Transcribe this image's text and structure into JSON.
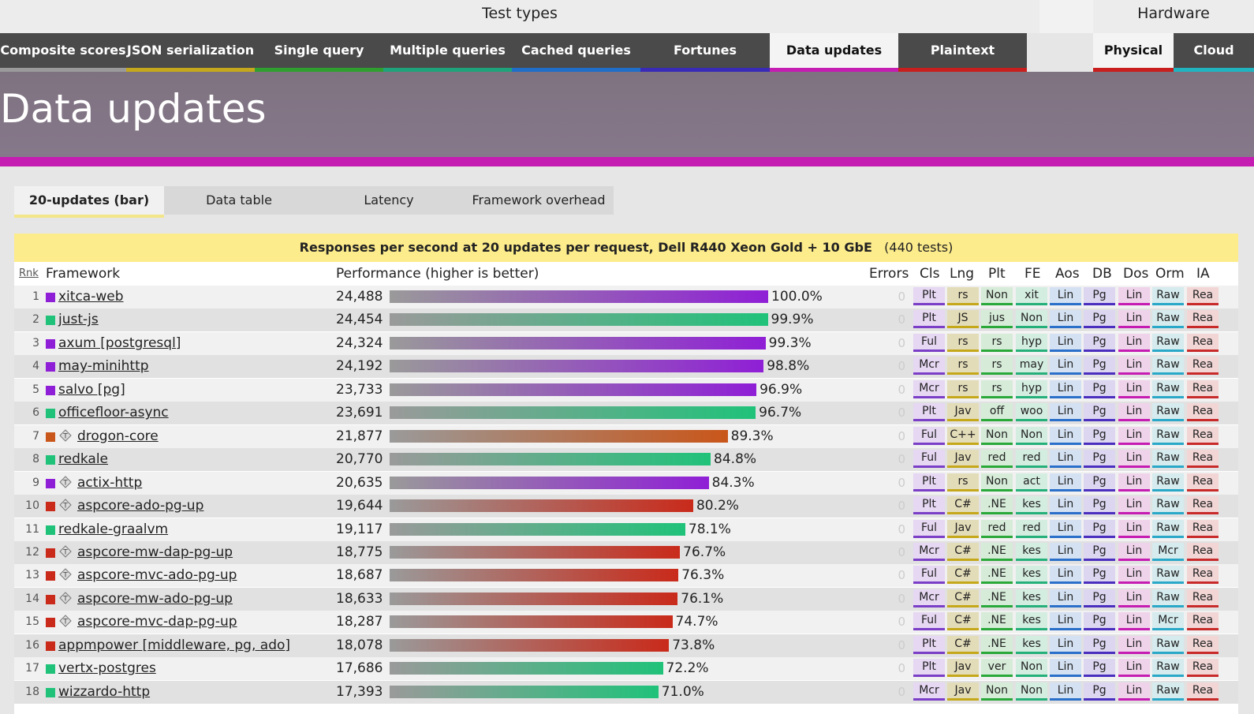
{
  "header": {
    "test_types_label": "Test types",
    "hardware_label": "Hardware"
  },
  "test_tabs": [
    {
      "label": "Composite scores",
      "color": "#9a9a9a",
      "active": false
    },
    {
      "label": "JSON serialization",
      "color": "#c4a71c",
      "active": false
    },
    {
      "label": "Single query",
      "color": "#2fa02f",
      "active": false
    },
    {
      "label": "Multiple queries",
      "color": "#1fa37a",
      "active": false
    },
    {
      "label": "Cached queries",
      "color": "#1f6ec8",
      "active": false
    },
    {
      "label": "Fortunes",
      "color": "#3a2ab8",
      "active": false
    },
    {
      "label": "Data updates",
      "color": "#c51cb2",
      "active": true
    },
    {
      "label": "Plaintext",
      "color": "#c81e1e",
      "active": false
    }
  ],
  "hardware_tabs": [
    {
      "label": "Physical",
      "color": "#c81e1e",
      "active": true
    },
    {
      "label": "Cloud",
      "color": "#1fb4c0",
      "active": false
    }
  ],
  "page_title": "Data updates",
  "sub_tabs": [
    {
      "label": "20-updates (bar)",
      "active": true
    },
    {
      "label": "Data table",
      "active": false
    },
    {
      "label": "Latency",
      "active": false
    },
    {
      "label": "Framework overhead",
      "active": false
    }
  ],
  "panel": {
    "title": "Responses per second at 20 updates per request, Dell R440 Xeon Gold + 10 GbE",
    "tests": "(440 tests)"
  },
  "columns": {
    "rnk": "Rnk",
    "framework": "Framework",
    "performance": "Performance (higher is better)",
    "errors": "Errors",
    "cls": "Cls",
    "lng": "Lng",
    "plt": "Plt",
    "fe": "FE",
    "aos": "Aos",
    "db": "DB",
    "dos": "Dos",
    "orm": "Orm",
    "ia": "IA"
  },
  "colors": {
    "purple": "#8f1fd6",
    "green": "#20c27a",
    "orange": "#c9561a",
    "red": "#c92a1a"
  },
  "rows": [
    {
      "rank": "1",
      "name": "xitca-web",
      "color": "purple",
      "tagged": false,
      "rps": "24,488",
      "pct_label": "100.0%",
      "pct": 100.0,
      "errors": "0",
      "attrs": [
        "Plt",
        "rs",
        "Non",
        "xit",
        "Lin",
        "Pg",
        "Lin",
        "Raw",
        "Rea"
      ]
    },
    {
      "rank": "2",
      "name": "just-js",
      "color": "green",
      "tagged": false,
      "rps": "24,454",
      "pct_label": "99.9%",
      "pct": 99.9,
      "errors": "0",
      "attrs": [
        "Plt",
        "JS",
        "jus",
        "Non",
        "Lin",
        "Pg",
        "Lin",
        "Raw",
        "Rea"
      ]
    },
    {
      "rank": "3",
      "name": "axum [postgresql]",
      "color": "purple",
      "tagged": false,
      "rps": "24,324",
      "pct_label": "99.3%",
      "pct": 99.3,
      "errors": "0",
      "attrs": [
        "Ful",
        "rs",
        "rs",
        "hyp",
        "Lin",
        "Pg",
        "Lin",
        "Raw",
        "Rea"
      ]
    },
    {
      "rank": "4",
      "name": "may-minihttp",
      "color": "purple",
      "tagged": false,
      "rps": "24,192",
      "pct_label": "98.8%",
      "pct": 98.8,
      "errors": "0",
      "attrs": [
        "Mcr",
        "rs",
        "rs",
        "may",
        "Lin",
        "Pg",
        "Lin",
        "Raw",
        "Rea"
      ]
    },
    {
      "rank": "5",
      "name": "salvo [pg]",
      "color": "purple",
      "tagged": false,
      "rps": "23,733",
      "pct_label": "96.9%",
      "pct": 96.9,
      "errors": "0",
      "attrs": [
        "Mcr",
        "rs",
        "rs",
        "hyp",
        "Lin",
        "Pg",
        "Lin",
        "Raw",
        "Rea"
      ]
    },
    {
      "rank": "6",
      "name": "officefloor-async",
      "color": "green",
      "tagged": false,
      "rps": "23,691",
      "pct_label": "96.7%",
      "pct": 96.7,
      "errors": "0",
      "attrs": [
        "Plt",
        "Jav",
        "off",
        "woo",
        "Lin",
        "Pg",
        "Lin",
        "Raw",
        "Rea"
      ]
    },
    {
      "rank": "7",
      "name": "drogon-core",
      "color": "orange",
      "tagged": true,
      "rps": "21,877",
      "pct_label": "89.3%",
      "pct": 89.3,
      "errors": "0",
      "attrs": [
        "Ful",
        "C++",
        "Non",
        "Non",
        "Lin",
        "Pg",
        "Lin",
        "Raw",
        "Rea"
      ]
    },
    {
      "rank": "8",
      "name": "redkale",
      "color": "green",
      "tagged": false,
      "rps": "20,770",
      "pct_label": "84.8%",
      "pct": 84.8,
      "errors": "0",
      "attrs": [
        "Ful",
        "Jav",
        "red",
        "red",
        "Lin",
        "Pg",
        "Lin",
        "Raw",
        "Rea"
      ]
    },
    {
      "rank": "9",
      "name": "actix-http",
      "color": "purple",
      "tagged": true,
      "rps": "20,635",
      "pct_label": "84.3%",
      "pct": 84.3,
      "errors": "0",
      "attrs": [
        "Plt",
        "rs",
        "Non",
        "act",
        "Lin",
        "Pg",
        "Lin",
        "Raw",
        "Rea"
      ]
    },
    {
      "rank": "10",
      "name": "aspcore-ado-pg-up",
      "color": "red",
      "tagged": true,
      "rps": "19,644",
      "pct_label": "80.2%",
      "pct": 80.2,
      "errors": "0",
      "attrs": [
        "Plt",
        "C#",
        ".NE",
        "kes",
        "Lin",
        "Pg",
        "Lin",
        "Raw",
        "Rea"
      ]
    },
    {
      "rank": "11",
      "name": "redkale-graalvm",
      "color": "green",
      "tagged": false,
      "rps": "19,117",
      "pct_label": "78.1%",
      "pct": 78.1,
      "errors": "0",
      "attrs": [
        "Ful",
        "Jav",
        "red",
        "red",
        "Lin",
        "Pg",
        "Lin",
        "Raw",
        "Rea"
      ]
    },
    {
      "rank": "12",
      "name": "aspcore-mw-dap-pg-up",
      "color": "red",
      "tagged": true,
      "rps": "18,775",
      "pct_label": "76.7%",
      "pct": 76.7,
      "errors": "0",
      "attrs": [
        "Mcr",
        "C#",
        ".NE",
        "kes",
        "Lin",
        "Pg",
        "Lin",
        "Mcr",
        "Rea"
      ]
    },
    {
      "rank": "13",
      "name": "aspcore-mvc-ado-pg-up",
      "color": "red",
      "tagged": true,
      "rps": "18,687",
      "pct_label": "76.3%",
      "pct": 76.3,
      "errors": "0",
      "attrs": [
        "Ful",
        "C#",
        ".NE",
        "kes",
        "Lin",
        "Pg",
        "Lin",
        "Raw",
        "Rea"
      ]
    },
    {
      "rank": "14",
      "name": "aspcore-mw-ado-pg-up",
      "color": "red",
      "tagged": true,
      "rps": "18,633",
      "pct_label": "76.1%",
      "pct": 76.1,
      "errors": "0",
      "attrs": [
        "Mcr",
        "C#",
        ".NE",
        "kes",
        "Lin",
        "Pg",
        "Lin",
        "Raw",
        "Rea"
      ]
    },
    {
      "rank": "15",
      "name": "aspcore-mvc-dap-pg-up",
      "color": "red",
      "tagged": true,
      "rps": "18,287",
      "pct_label": "74.7%",
      "pct": 74.7,
      "errors": "0",
      "attrs": [
        "Ful",
        "C#",
        ".NE",
        "kes",
        "Lin",
        "Pg",
        "Lin",
        "Mcr",
        "Rea"
      ]
    },
    {
      "rank": "16",
      "name": "appmpower [middleware, pg, ado]",
      "color": "red",
      "tagged": false,
      "rps": "18,078",
      "pct_label": "73.8%",
      "pct": 73.8,
      "errors": "0",
      "attrs": [
        "Plt",
        "C#",
        ".NE",
        "kes",
        "Lin",
        "Pg",
        "Lin",
        "Raw",
        "Rea"
      ]
    },
    {
      "rank": "17",
      "name": "vertx-postgres",
      "color": "green",
      "tagged": false,
      "rps": "17,686",
      "pct_label": "72.2%",
      "pct": 72.2,
      "errors": "0",
      "attrs": [
        "Plt",
        "Jav",
        "ver",
        "Non",
        "Lin",
        "Pg",
        "Lin",
        "Raw",
        "Rea"
      ]
    },
    {
      "rank": "18",
      "name": "wizzardo-http",
      "color": "green",
      "tagged": false,
      "rps": "17,393",
      "pct_label": "71.0%",
      "pct": 71.0,
      "errors": "0",
      "attrs": [
        "Mcr",
        "Jav",
        "Non",
        "Non",
        "Lin",
        "Pg",
        "Lin",
        "Raw",
        "Rea"
      ]
    }
  ]
}
